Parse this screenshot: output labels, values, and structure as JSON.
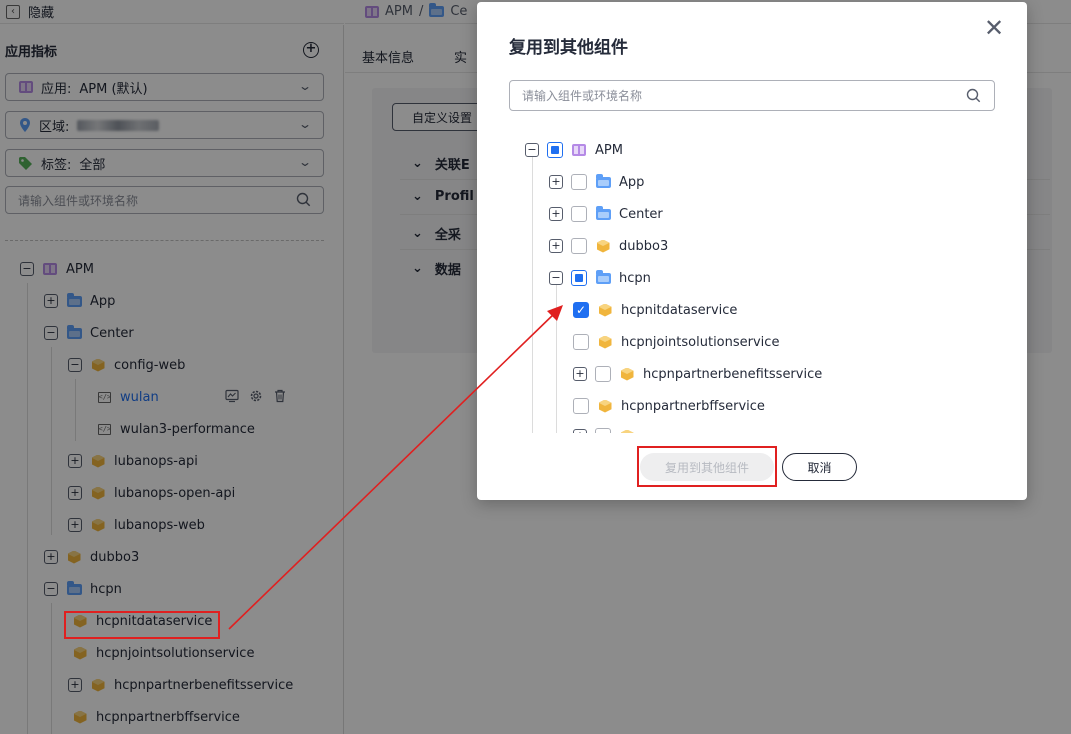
{
  "colors": {
    "accent": "#1f6ff1",
    "highlight": "#e02020",
    "folder": "#5e9ff7",
    "service": "#f0b53d"
  },
  "topbar": {
    "hide_label": "隐藏"
  },
  "sidebar": {
    "title": "应用指标",
    "app_select": {
      "label": "应用:",
      "value": "APM (默认)"
    },
    "region_select": {
      "label": "区域:",
      "value": ""
    },
    "tag_select": {
      "label": "标签:",
      "value": "全部"
    },
    "search_placeholder": "请输入组件或环境名称",
    "tree": [
      {
        "label": "APM",
        "icon": "apm-icon",
        "toggle": "−"
      },
      {
        "label": "App",
        "icon": "folder-icon",
        "toggle": "+"
      },
      {
        "label": "Center",
        "icon": "folder-icon",
        "toggle": "−"
      },
      {
        "label": "config-web",
        "icon": "cube-icon",
        "toggle": "−"
      },
      {
        "label": "wulan",
        "icon": "code-icon",
        "toggle": ""
      },
      {
        "label": "wulan3-performance",
        "icon": "code-icon",
        "toggle": ""
      },
      {
        "label": "lubanops-api",
        "icon": "cube-icon",
        "toggle": "+"
      },
      {
        "label": "lubanops-open-api",
        "icon": "cube-icon",
        "toggle": "+"
      },
      {
        "label": "lubanops-web",
        "icon": "cube-icon",
        "toggle": "+"
      },
      {
        "label": "dubbo3",
        "icon": "cube-icon",
        "toggle": "+"
      },
      {
        "label": "hcpn",
        "icon": "folder-icon",
        "toggle": "−"
      },
      {
        "label": "hcpnitdataservice",
        "icon": "cube-icon",
        "toggle": ""
      },
      {
        "label": "hcpnjointsolutionservice",
        "icon": "cube-icon",
        "toggle": ""
      },
      {
        "label": "hcpnpartnerbenefitsservice",
        "icon": "cube-icon",
        "toggle": "+"
      },
      {
        "label": "hcpnpartnerbffservice",
        "icon": "cube-icon",
        "toggle": ""
      }
    ]
  },
  "main": {
    "breadcrumb": [
      "APM",
      "/",
      "Ce"
    ],
    "tabs": [
      "基本信息",
      "实"
    ],
    "custom_button": "自定义设置",
    "accordion": [
      "关联E",
      "Profil",
      "全采",
      "数据"
    ]
  },
  "modal": {
    "title": "复用到其他组件",
    "close": "✕",
    "search_placeholder": "请输入组件或环境名称",
    "tree": [
      {
        "label": "APM",
        "icon": "apm-icon",
        "toggle": "−",
        "check": "partial"
      },
      {
        "label": "App",
        "icon": "folder-icon",
        "toggle": "+",
        "check": "none"
      },
      {
        "label": "Center",
        "icon": "folder-icon",
        "toggle": "+",
        "check": "none"
      },
      {
        "label": "dubbo3",
        "icon": "cube-icon",
        "toggle": "+",
        "check": "none"
      },
      {
        "label": "hcpn",
        "icon": "folder-icon",
        "toggle": "−",
        "check": "partial"
      },
      {
        "label": "hcpnitdataservice",
        "icon": "cube-icon",
        "toggle": "",
        "check": "checked"
      },
      {
        "label": "hcpnjointsolutionservice",
        "icon": "cube-icon",
        "toggle": "",
        "check": "none"
      },
      {
        "label": "hcpnpartnerbenefitsservice",
        "icon": "cube-icon",
        "toggle": "+",
        "check": "none"
      },
      {
        "label": "hcpnpartnerbffservice",
        "icon": "cube-icon",
        "toggle": "",
        "check": "none"
      }
    ],
    "confirm_button": "复用到其他组件",
    "cancel_button": "取消"
  }
}
